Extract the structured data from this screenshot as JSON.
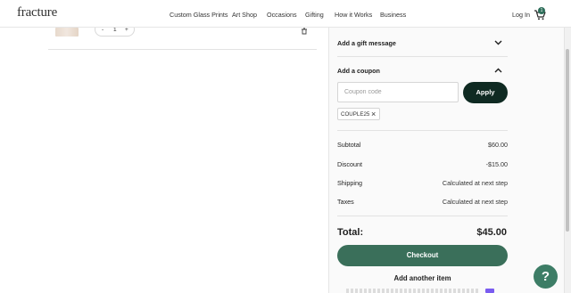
{
  "header": {
    "logo": "fracture",
    "nav": [
      "Custom Glass Prints",
      "Art Shop",
      "Occasions",
      "Gifting",
      "How it Works",
      "Business"
    ],
    "login": "Log In",
    "cart_count": "1"
  },
  "cart_item": {
    "quantity": "1",
    "minus": "-",
    "plus": "+"
  },
  "summary": {
    "gift_message_label": "Add a gift message",
    "coupon_label": "Add a coupon",
    "coupon_placeholder": "Coupon code",
    "apply_label": "Apply",
    "applied_coupon": "COUPLE25",
    "remove_symbol": "×",
    "lines": [
      {
        "label": "Subtotal",
        "value": "$60.00"
      },
      {
        "label": "Discount",
        "value": "-$15.00"
      },
      {
        "label": "Shipping",
        "value": "Calculated at next step"
      },
      {
        "label": "Taxes",
        "value": "Calculated at next step"
      }
    ],
    "total_label": "Total:",
    "total_value": "$45.00",
    "checkout_label": "Checkout",
    "add_item_label": "Add another item"
  },
  "help": {
    "label": "?"
  },
  "colors": {
    "primary_green": "#3a6f5a",
    "dark_button": "#0f2a22"
  }
}
